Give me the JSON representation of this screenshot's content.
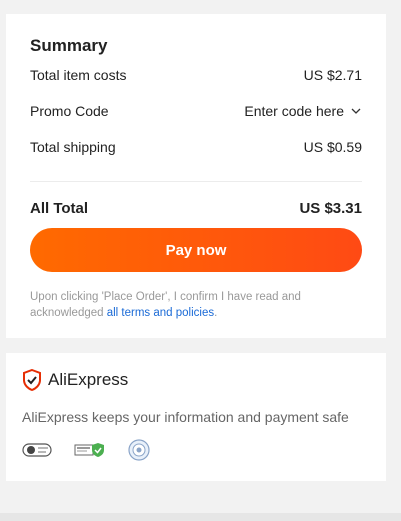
{
  "summary": {
    "title": "Summary",
    "item_costs_label": "Total item costs",
    "item_costs_value": "US $2.71",
    "promo_label": "Promo Code",
    "promo_value": "Enter code here",
    "shipping_label": "Total shipping",
    "shipping_value": "US $0.59",
    "total_label": "All Total",
    "total_value": "US $3.31",
    "pay_button": "Pay now",
    "disclaimer_text": "Upon clicking 'Place Order', I confirm I have read and acknowledged ",
    "disclaimer_link": "all terms and policies",
    "disclaimer_end": "."
  },
  "trust": {
    "brand": "AliExpress",
    "message": "AliExpress keeps your information and payment safe",
    "badges": [
      "security-badge-icon",
      "payment-secure-icon",
      "certified-seal-icon"
    ]
  },
  "colors": {
    "accent_start": "#ff6a00",
    "accent_end": "#ff4a14",
    "link": "#1a6ad6",
    "brand_red": "#e62e04"
  }
}
